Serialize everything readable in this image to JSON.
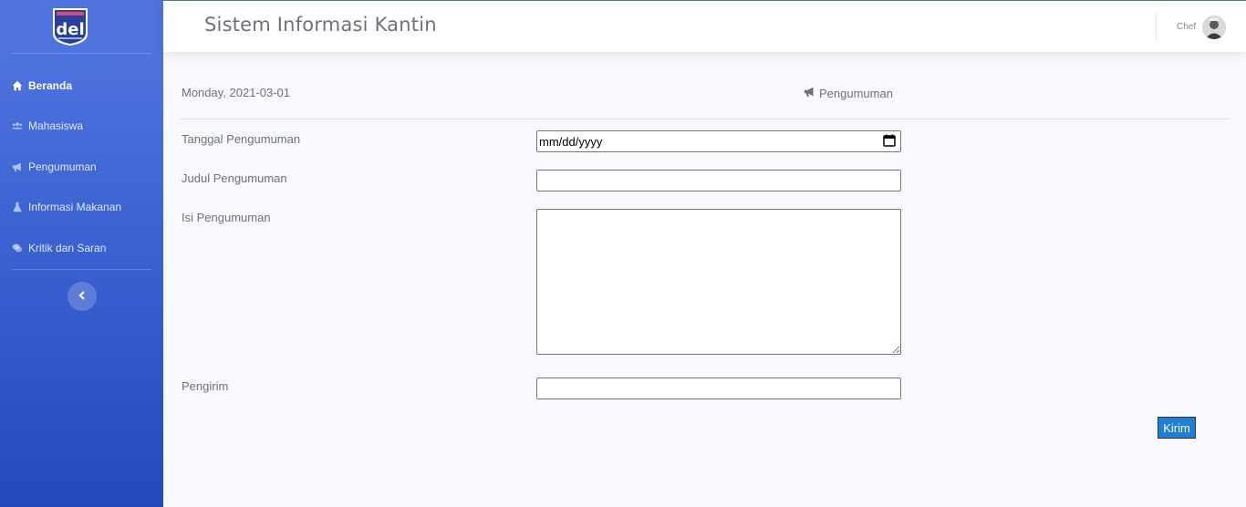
{
  "sidebar": {
    "logo_alt": "del",
    "items": [
      {
        "label": "Beranda",
        "icon": "home-icon",
        "active": true
      },
      {
        "label": "Mahasiswa",
        "icon": "users-icon",
        "active": false
      },
      {
        "label": "Pengumuman",
        "icon": "bullhorn-icon",
        "active": false
      },
      {
        "label": "Informasi Makanan",
        "icon": "flask-icon",
        "active": false
      },
      {
        "label": "Kritik dan Saran",
        "icon": "comments-icon",
        "active": false
      }
    ],
    "toggle_icon": "chevron-left-icon"
  },
  "topbar": {
    "title": "Sistem Informasi Kantin",
    "user_name": "Chef"
  },
  "content": {
    "date": "Monday, 2021-03-01",
    "heading": "Pengumuman",
    "heading_icon": "bullhorn-icon"
  },
  "form": {
    "tanggal_label": "Tanggal Pengumuman",
    "tanggal_placeholder": "mm/dd/yyyy",
    "judul_label": "Judul Pengumuman",
    "judul_value": "",
    "isi_label": "Isi Pengumuman",
    "isi_value": "",
    "pengirim_label": "Pengirim",
    "pengirim_value": "",
    "submit_label": "Kirim"
  },
  "colors": {
    "sidebar_top": "#4e73df",
    "sidebar_bottom": "#224abe",
    "submit": "#1e7fd3"
  }
}
